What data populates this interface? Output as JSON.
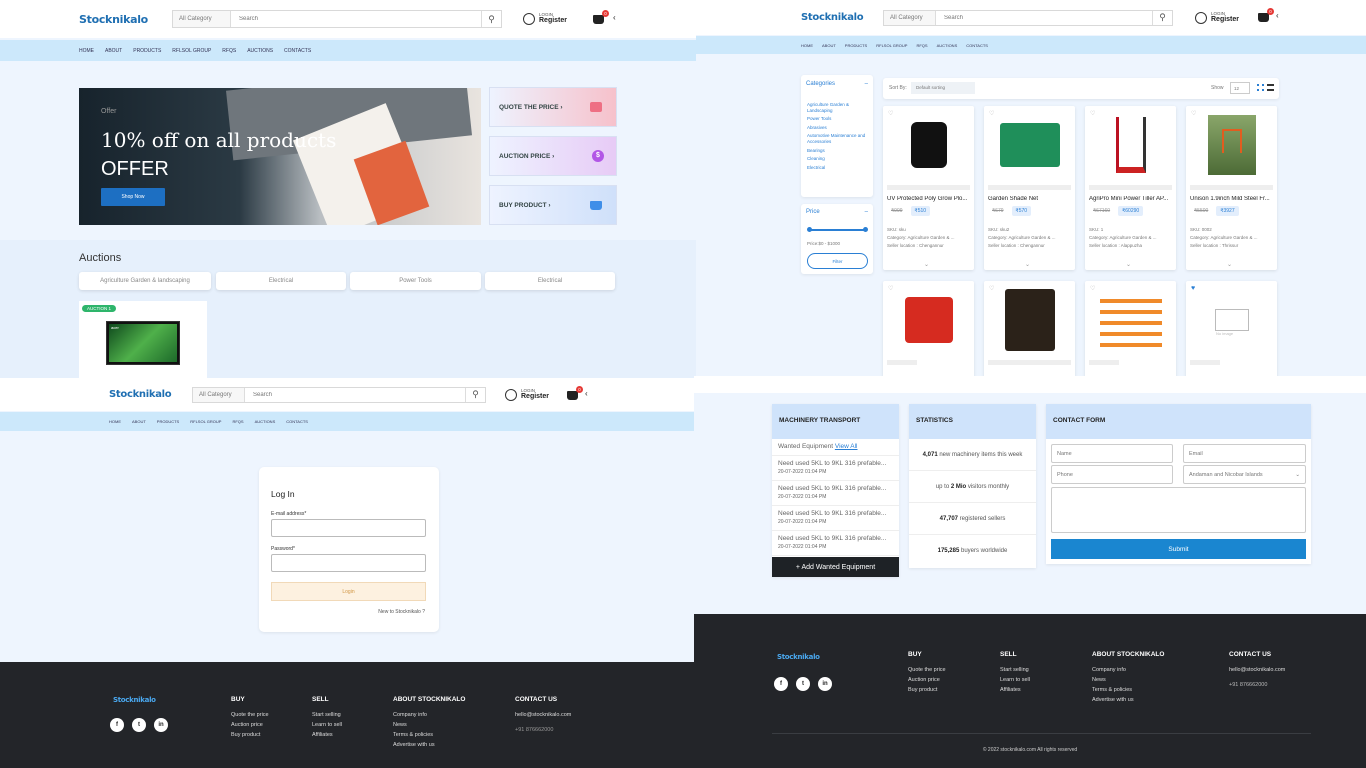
{
  "brand": "Stocknikalo",
  "header": {
    "category": "All Category",
    "search_placeholder": "Search",
    "login": "LOGIN",
    "register": "Register",
    "cart_count": "0"
  },
  "nav": [
    "HOME",
    "ABOUT",
    "PRODUCTS",
    "RFLSOL GROUP",
    "RFQS",
    "AUCTIONS",
    "CONTACTS"
  ],
  "home": {
    "banner": {
      "tag": "Offer",
      "title_line1": "10% off on all products",
      "title_line2": "OFFER",
      "button": "Shop Now"
    },
    "side_tiles": [
      "QUOTE THE PRICE",
      "AUCTION PRICE",
      "BUY PRODUCT"
    ],
    "auctions_title": "Auctions",
    "auction_tabs": [
      "Agriculture Garden & landscaping",
      "Electrical",
      "Power Tools",
      "Electrical"
    ],
    "auction_badge": "AUCTION 1",
    "tv_brand": "acer"
  },
  "shop": {
    "categories_title": "Categories",
    "categories": [
      "Agriculture Garden & Landscaping",
      "Power Tools",
      "Abrasives",
      "Automotive Maintenance and Accessories",
      "Bearings",
      "Cleaning",
      "Electrical"
    ],
    "price_title": "Price",
    "price_range": "Price:$0 - $1000",
    "filter_button": "Filter",
    "sort_label": "Sort By:",
    "sort_value": "Default sorting",
    "show_label": "Show",
    "show_value": "12",
    "products": [
      {
        "name": "UV Protected Poly Grow Plo...",
        "old": "₹999",
        "new": "₹510",
        "sku": "SKU: sku",
        "category": "Category: Agriculture Garden & ...",
        "location": "Seller location : Chengannur"
      },
      {
        "name": "Garden Shade Net",
        "old": "₹679",
        "new": "₹570",
        "sku": "SKU: sku2",
        "category": "Category: Agriculture Garden & ...",
        "location": "Seller location : Chengannur"
      },
      {
        "name": "AgriPro Mini Power Tiller AP...",
        "old": "₹67160",
        "new": "₹60290",
        "sku": "SKU: 1",
        "category": "Category: Agriculture Garden & ...",
        "location": "Seller location : Alappuzha"
      },
      {
        "name": "Unison 1.9inch Mild Steel Fr...",
        "old": "₹5500",
        "new": "₹3927",
        "sku": "SKU: 0002",
        "category": "Category: Agriculture Garden & ...",
        "location": "Seller location : Thrissur"
      }
    ],
    "no_image": "No image"
  },
  "login": {
    "title": "Log In",
    "email_label": "E-mail address*",
    "password_label": "Password*",
    "button": "Login",
    "new_link": "New to Stocknikalo ?"
  },
  "machinery": {
    "title": "MACHINERY TRANSPORT",
    "wanted": "Wanted Equipment",
    "view_all": "View All",
    "rows": [
      {
        "text": "Need used 5KL to 9KL 316 prefable...",
        "date": "20-07-2022 01:04 PM"
      },
      {
        "text": "Need used 5KL to 9KL 316 prefable...",
        "date": "20-07-2022 01:04 PM"
      },
      {
        "text": "Need used 5KL to 9KL 316 prefable...",
        "date": "20-07-2022 01:04 PM"
      },
      {
        "text": "Need used 5KL to 9KL 316 prefable...",
        "date": "20-07-2022 01:04 PM"
      }
    ],
    "add_button": "+ Add Wanted Equipment"
  },
  "statistics": {
    "title": "STATISTICS",
    "items": [
      {
        "num": "4,071",
        "text": " new machinery items this week"
      },
      {
        "num": "2 Mio",
        "pre": "up to ",
        "text": " visitors monthly"
      },
      {
        "num": "47,707",
        "text": " registered sellers"
      },
      {
        "num": "175,285",
        "text": " buyers worldwide"
      }
    ]
  },
  "contact_form": {
    "title": "CONTACT FORM",
    "name": "Name",
    "email": "Email",
    "phone": "Phone",
    "state": "Andaman and Nicobar Islands",
    "submit": "Submit"
  },
  "footer": {
    "buy_title": "BUY",
    "buy": [
      "Quote the price",
      "Auction price",
      "Buy product"
    ],
    "sell_title": "SELL",
    "sell": [
      "Start selling",
      "Learn to sell",
      "Affiliates"
    ],
    "about_title": "ABOUT STOCKNIKALO",
    "about": [
      "Company info",
      "News",
      "Terms & policies",
      "Advertise with us"
    ],
    "contact_title": "CONTACT US",
    "email": "hello@stocknikalo.com",
    "phone": "+91 876662000",
    "copyright": "© 2022 stocknikalo.com All rights reserved"
  },
  "colors": {
    "accent": "#2a7fd4",
    "nav": "#cce8fb",
    "footer": "#232529",
    "submit": "#1a86d0"
  }
}
